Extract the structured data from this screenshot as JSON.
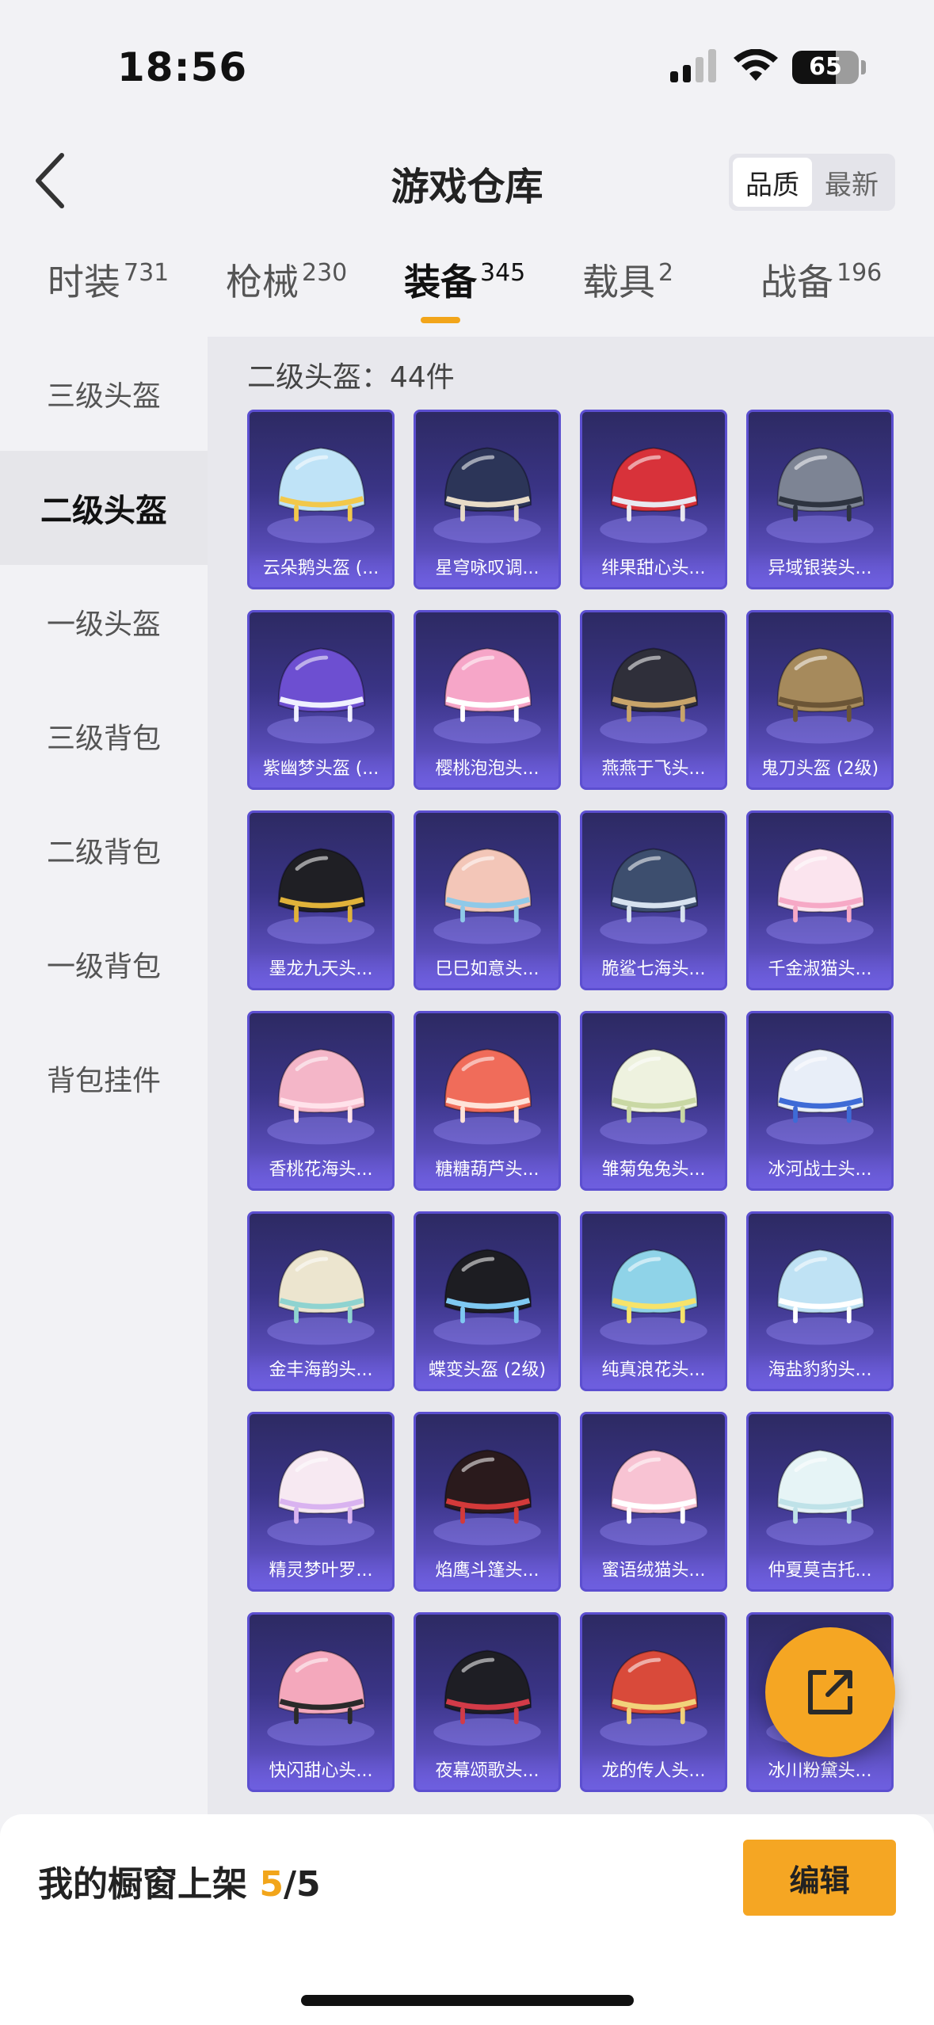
{
  "status_bar": {
    "time": "18:56",
    "battery_percent": "65",
    "battery_level": 0.65
  },
  "header": {
    "title": "游戏仓库",
    "sort_options": [
      {
        "label": "品质",
        "active": true
      },
      {
        "label": "最新",
        "active": false
      }
    ]
  },
  "tabs": [
    {
      "label": "时装",
      "count": "731",
      "active": false
    },
    {
      "label": "枪械",
      "count": "230",
      "active": false
    },
    {
      "label": "装备",
      "count": "345",
      "active": true
    },
    {
      "label": "载具",
      "count": "2",
      "active": false
    },
    {
      "label": "战备",
      "count": "196",
      "active": false
    }
  ],
  "sidebar": {
    "items": [
      {
        "label": "三级头盔",
        "active": false
      },
      {
        "label": "二级头盔",
        "active": true
      },
      {
        "label": "一级头盔",
        "active": false
      },
      {
        "label": "三级背包",
        "active": false
      },
      {
        "label": "二级背包",
        "active": false
      },
      {
        "label": "一级背包",
        "active": false
      },
      {
        "label": "背包挂件",
        "active": false
      }
    ]
  },
  "main": {
    "section_title": "二级头盔：44件",
    "items": [
      {
        "name": "云朵鹅头盔 (...",
        "art_color": "#bfe3f7",
        "accent": "#f2c84b"
      },
      {
        "name": "星穹咏叹调...",
        "art_color": "#2c3558",
        "accent": "#e8dcc8"
      },
      {
        "name": "绯果甜心头...",
        "art_color": "#d8323a",
        "accent": "#e8e8f0"
      },
      {
        "name": "异域银装头...",
        "art_color": "#7d8494",
        "accent": "#2e3440"
      },
      {
        "name": "紫幽梦头盔 (...",
        "art_color": "#6d4fd1",
        "accent": "#f0f0ff"
      },
      {
        "name": "樱桃泡泡头...",
        "art_color": "#f6a6c8",
        "accent": "#ffffff"
      },
      {
        "name": "燕燕于飞头...",
        "art_color": "#2f2f3a",
        "accent": "#c8a46a"
      },
      {
        "name": "鬼刀头盔 (2级)",
        "art_color": "#a68a5c",
        "accent": "#6b5536"
      },
      {
        "name": "墨龙九天头...",
        "art_color": "#1f1f24",
        "accent": "#e0b23a"
      },
      {
        "name": "巳巳如意头...",
        "art_color": "#f3c6b8",
        "accent": "#8fc9e8"
      },
      {
        "name": "脆鲨七海头...",
        "art_color": "#3d4e6e",
        "accent": "#d7e2ef"
      },
      {
        "name": "千金淑猫头...",
        "art_color": "#fbe4ee",
        "accent": "#f6a9c6"
      },
      {
        "name": "香桃花海头...",
        "art_color": "#f4b6c8",
        "accent": "#ffe2ea"
      },
      {
        "name": "糖糖葫芦头...",
        "art_color": "#f06c5a",
        "accent": "#ffe3d8"
      },
      {
        "name": "雏菊兔兔头...",
        "art_color": "#eef2df",
        "accent": "#c9d8a4"
      },
      {
        "name": "冰河战士头...",
        "art_color": "#e8eef8",
        "accent": "#3e6bd6"
      },
      {
        "name": "金丰海韵头...",
        "art_color": "#ece5cf",
        "accent": "#8fd3d0"
      },
      {
        "name": "蝶变头盔 (2级)",
        "art_color": "#1d1d22",
        "accent": "#7fc9f2"
      },
      {
        "name": "纯真浪花头...",
        "art_color": "#8fd3e8",
        "accent": "#f7e36a"
      },
      {
        "name": "海盐豹豹头...",
        "art_color": "#bfe2f4",
        "accent": "#ffffff"
      },
      {
        "name": "精灵梦叶罗...",
        "art_color": "#f7e9f2",
        "accent": "#d9b3f0"
      },
      {
        "name": "焰鹰斗篷头...",
        "art_color": "#2a1a1c",
        "accent": "#d33a3a"
      },
      {
        "name": "蜜语绒猫头...",
        "art_color": "#f8c3d3",
        "accent": "#ffffff"
      },
      {
        "name": "仲夏莫吉托...",
        "art_color": "#e6f4f6",
        "accent": "#bfe2e8"
      },
      {
        "name": "快闪甜心头...",
        "art_color": "#f4a8bc",
        "accent": "#2a2a2a"
      },
      {
        "name": "夜幕颂歌头...",
        "art_color": "#1e1e24",
        "accent": "#d23b48"
      },
      {
        "name": "龙的传人头...",
        "art_color": "#d94a3a",
        "accent": "#f2d27a"
      },
      {
        "name": "冰川粉黛头...",
        "art_color": "#bfe3f4",
        "accent": "#f6b6cc"
      }
    ]
  },
  "bottom_bar": {
    "showcase_label": "我的橱窗上架",
    "showcase_current": "5",
    "showcase_total": "/5",
    "edit_label": "编辑"
  },
  "colors": {
    "accent": "#f5a623",
    "card_top": "#2d2a63",
    "card_bottom": "#6b5bd6"
  }
}
